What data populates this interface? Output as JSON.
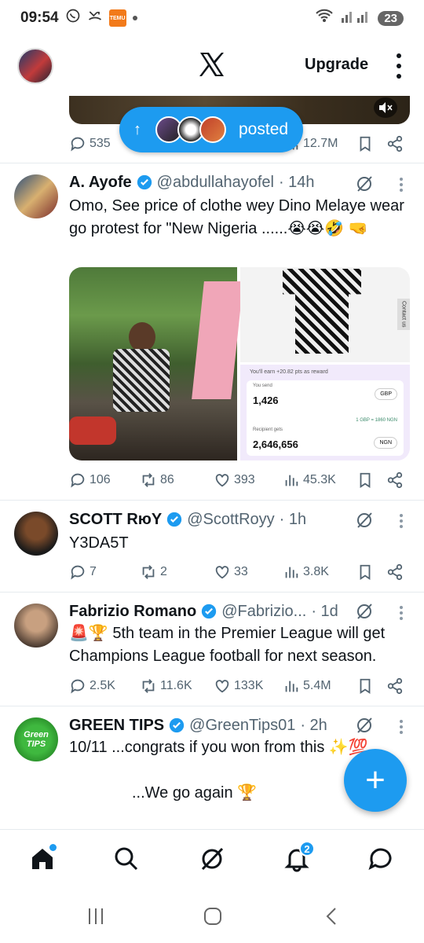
{
  "status_bar": {
    "time": "09:54",
    "temu_label": "TEMU",
    "battery": "23"
  },
  "header": {
    "upgrade_label": "Upgrade"
  },
  "posted_pill": {
    "label": "posted",
    "arrow": "↑"
  },
  "first_tweet_stats": {
    "replies": "535",
    "views": "12.7M"
  },
  "tweets": [
    {
      "name": "A. Ayofe",
      "handle": "@abdullahayofel",
      "time": "· 14h",
      "text": "Omo, See price of clothe wey Dino Melaye wear go protest for \"New Nigeria ......😭😭🤣 🤜",
      "replies": "106",
      "retweets": "86",
      "likes": "393",
      "views": "45.3K",
      "media": {
        "banner": "You'll earn +20.82 pts as reward",
        "send_label": "You send",
        "send_value": "1,426",
        "send_currency": "GBP",
        "rate": "1 GBP = 1860 NGN",
        "receive_label": "Recipient gets",
        "receive_value": "2,646,656",
        "receive_currency": "NGN",
        "side_tag": "Contact us"
      }
    },
    {
      "name": "SCOTT RюY",
      "handle": "@ScottRoyy",
      "time": "· 1h",
      "text": "Y3DA5T",
      "replies": "7",
      "retweets": "2",
      "likes": "33",
      "views": "3.8K"
    },
    {
      "name": "Fabrizio Romano",
      "handle": "@Fabrizio...",
      "time": "· 1d",
      "text": "🚨🏆 5th team in the Premier League will get Champions League football for next season.",
      "replies": "2.5K",
      "retweets": "11.6K",
      "likes": "133K",
      "views": "5.4M"
    },
    {
      "name": "GREEN TIPS",
      "handle": "@GreenTips01",
      "time": "· 2h",
      "text_line1": "10/11 ...congrats if you won from this ✨💯",
      "text_line2": "...We go again 🏆",
      "avatar_text": "Green TIPS"
    }
  ],
  "bottom_nav": {
    "notification_count": "2"
  },
  "fab": {
    "icon": "+"
  },
  "icons": {
    "accent": "#1d9bf0",
    "verified": "verified-badge-icon",
    "grok": "grok-icon"
  }
}
